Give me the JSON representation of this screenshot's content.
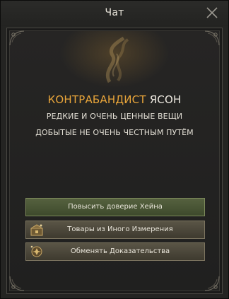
{
  "window": {
    "title": "Чат"
  },
  "npc": {
    "role": "КОНТРАБАНДИСТ",
    "name": "ЯСОН",
    "description_line1": "РЕДКИЕ И ОЧЕНЬ ЦЕННЫЕ ВЕЩИ",
    "description_line2": "ДОБЫТЫЕ НЕ ОЧЕНЬ ЧЕСТНЫМ ПУТЁМ"
  },
  "options": [
    {
      "label": "Повысить доверие Хейна",
      "style": "green",
      "icon": ""
    },
    {
      "label": "Товары из Иного Измерения",
      "style": "brown",
      "icon": "chest-icon"
    },
    {
      "label": "Обменять Доказательства",
      "style": "brown",
      "icon": "emblem-icon"
    }
  ],
  "colors": {
    "accent_gold": "#e8a53a",
    "button_green": "#56613f",
    "button_brown": "#5a5546"
  }
}
